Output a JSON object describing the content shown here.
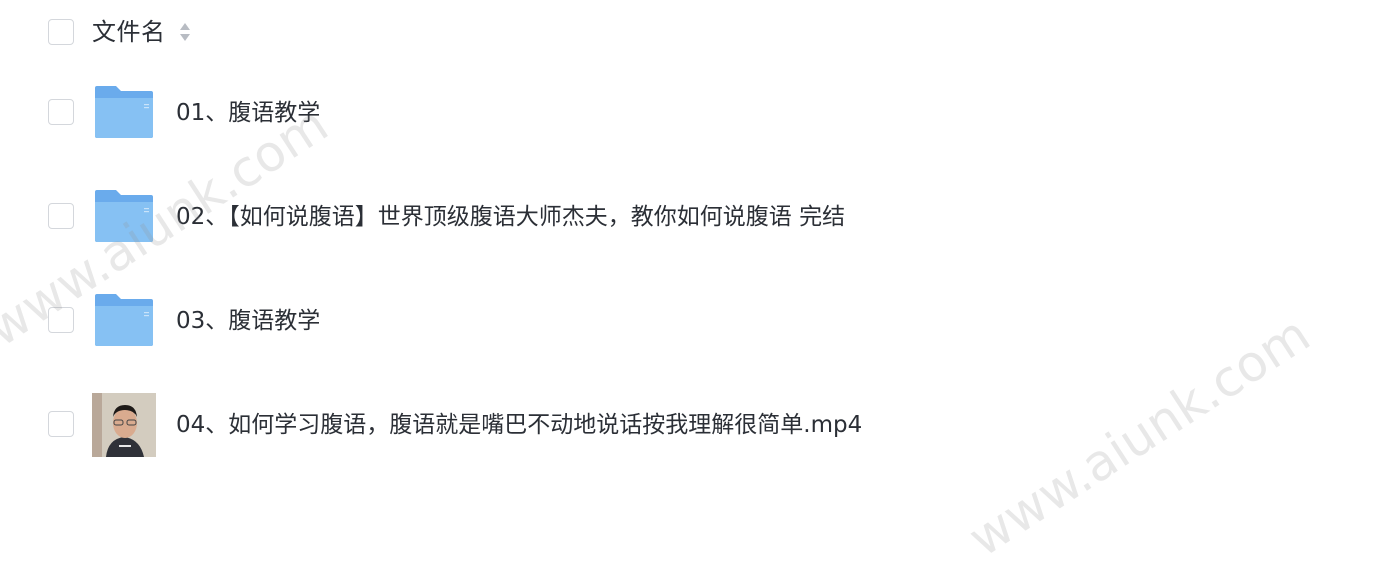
{
  "header": {
    "column_label": "文件名"
  },
  "files": [
    {
      "type": "folder",
      "name": "01、腹语教学",
      "icon": "folder-icon"
    },
    {
      "type": "folder",
      "name": "02、【如何说腹语】世界顶级腹语大师杰夫，教你如何说腹语 完结",
      "icon": "folder-icon"
    },
    {
      "type": "folder",
      "name": "03、腹语教学",
      "icon": "folder-icon"
    },
    {
      "type": "video",
      "name": "04、如何学习腹语，腹语就是嘴巴不动地说话按我理解很简单.mp4",
      "icon": "video-thumbnail"
    }
  ],
  "watermarks": [
    "www.aiunk.com",
    "www.aiunk.com"
  ],
  "colors": {
    "folder": "#7ab6ef",
    "checkbox_border": "#d4d7dc",
    "text": "#2b2f36"
  }
}
